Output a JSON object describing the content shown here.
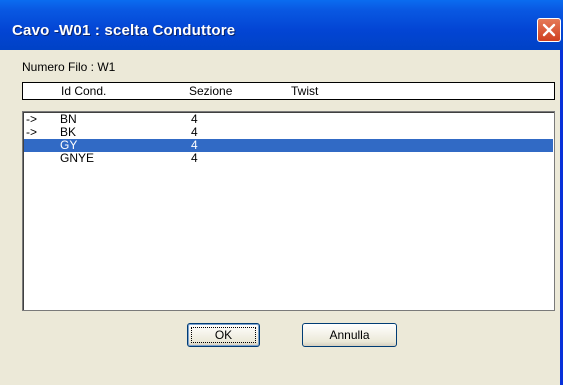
{
  "window": {
    "title": "Cavo -W01 : scelta Conduttore"
  },
  "numero_filo_label": "Numero Filo : W1",
  "columns": {
    "id_cond": "Id Cond.",
    "sezione": "Sezione",
    "twist": "Twist"
  },
  "rows": [
    {
      "marker": "->",
      "id": "BN",
      "sezione": "4",
      "twist": "",
      "selected": false
    },
    {
      "marker": "->",
      "id": "BK",
      "sezione": "4",
      "twist": "",
      "selected": false
    },
    {
      "marker": "",
      "id": "GY",
      "sezione": "4",
      "twist": "",
      "selected": true
    },
    {
      "marker": "",
      "id": "GNYE",
      "sezione": "4",
      "twist": "",
      "selected": false
    }
  ],
  "buttons": {
    "ok": "OK",
    "cancel": "Annulla"
  },
  "colors": {
    "titlebar": "#0345d4",
    "selection": "#316ac5",
    "dialog_bg": "#ece9d8"
  },
  "icons": {
    "close": "close-icon"
  }
}
